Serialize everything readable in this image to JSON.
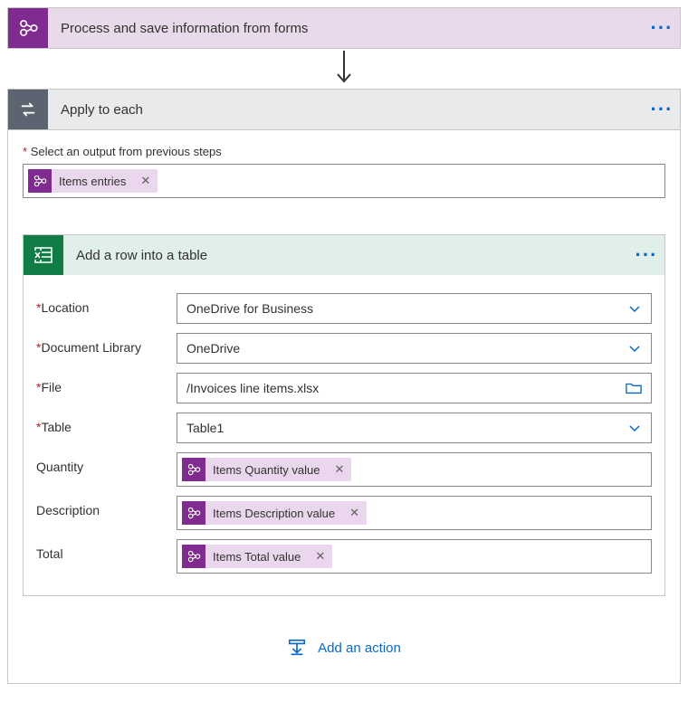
{
  "flow": {
    "process": {
      "title": "Process and save information from forms"
    },
    "applyToEach": {
      "title": "Apply to each",
      "outputLabel": "Select an output from previous steps",
      "outputToken": "Items entries"
    },
    "excelAction": {
      "title": "Add a row into a table",
      "fields": {
        "location": {
          "label": "Location",
          "value": "OneDrive for Business"
        },
        "documentLibrary": {
          "label": "Document Library",
          "value": "OneDrive"
        },
        "file": {
          "label": "File",
          "value": "/Invoices line items.xlsx"
        },
        "table": {
          "label": "Table",
          "value": "Table1"
        },
        "quantity": {
          "label": "Quantity",
          "token": "Items Quantity value"
        },
        "description": {
          "label": "Description",
          "token": "Items Description value"
        },
        "total": {
          "label": "Total",
          "token": "Items Total value"
        }
      }
    },
    "addAction": "Add an action"
  }
}
